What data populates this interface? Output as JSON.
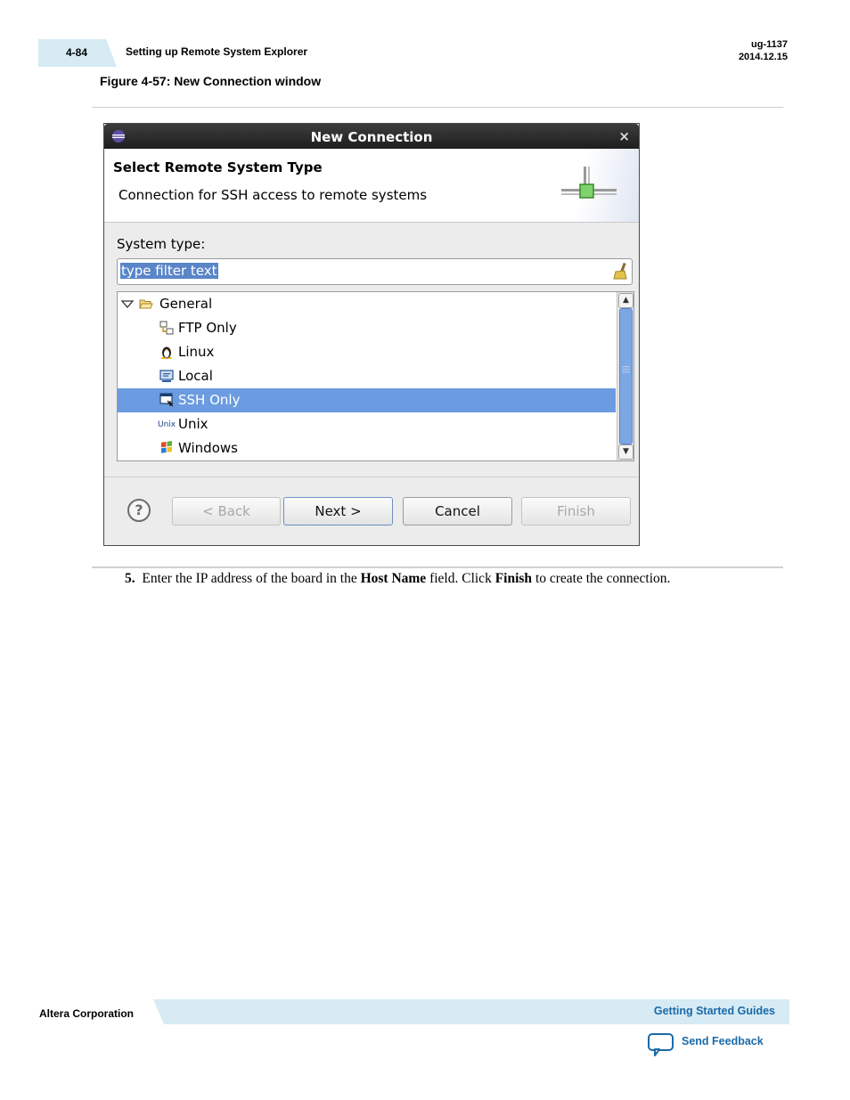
{
  "header": {
    "page_number": "4-84",
    "section_title": "Setting up Remote System Explorer",
    "doc_id": "ug-1137",
    "doc_date": "2014.12.15"
  },
  "figure_caption": "Figure 4-57: New Connection window",
  "dialog": {
    "title": "New Connection",
    "close_glyph": "×",
    "banner_title": "Select Remote System Type",
    "banner_subtitle": "Connection for SSH access to remote systems",
    "system_type_label": "System type:",
    "filter_placeholder": "type filter text",
    "tree": {
      "group": "General",
      "items": [
        {
          "label": "FTP Only",
          "icon": "ftp-icon",
          "selected": false
        },
        {
          "label": "Linux",
          "icon": "linux-penguin-icon",
          "selected": false
        },
        {
          "label": "Local",
          "icon": "local-computer-icon",
          "selected": false
        },
        {
          "label": "SSH Only",
          "icon": "ssh-terminal-icon",
          "selected": true
        },
        {
          "label": "Unix",
          "icon": "unix-icon",
          "selected": false
        },
        {
          "label": "Windows",
          "icon": "windows-icon",
          "selected": false
        }
      ],
      "unix_icon_text": "Unix"
    },
    "buttons": {
      "help": "?",
      "back": "< Back",
      "next": "Next >",
      "cancel": "Cancel",
      "finish": "Finish"
    },
    "colors": {
      "selection": "#6b9be0",
      "titlebar": "#2b2b2b"
    }
  },
  "step": {
    "number": "5.",
    "text_1": "Enter the IP address of the board in the ",
    "bold_1": "Host Name",
    "text_2": " field. Click ",
    "bold_2": "Finish",
    "text_3": " to create the connection."
  },
  "footer": {
    "company": "Altera Corporation",
    "guide": "Getting Started Guides",
    "feedback": "Send Feedback",
    "accent_color": "#1a6aa9",
    "band_color": "#d6ebf4"
  }
}
